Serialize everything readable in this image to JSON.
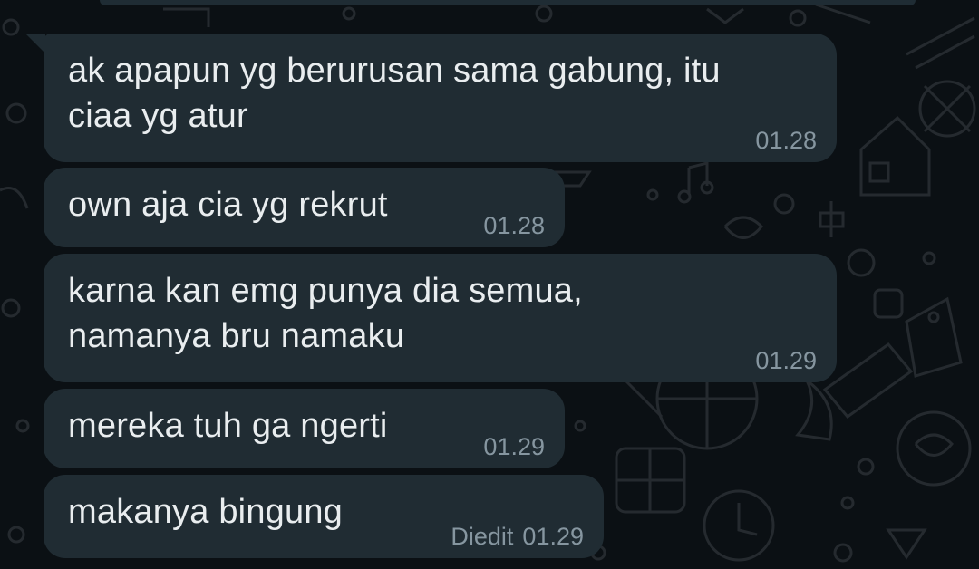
{
  "colors": {
    "background": "#0b1014",
    "bubble": "#202c33",
    "message_text": "#e9edef",
    "meta_text": "#8696a0"
  },
  "messages": [
    {
      "text": "ak apapun yg berurusan sama gabung, itu\nciaa yg atur",
      "time": "01.28",
      "edited_label": ""
    },
    {
      "text": "own aja cia yg rekrut",
      "time": "01.28",
      "edited_label": ""
    },
    {
      "text": "karna kan emg punya dia semua,\nnamanya bru namaku",
      "time": "01.29",
      "edited_label": ""
    },
    {
      "text": "mereka tuh ga ngerti",
      "time": "01.29",
      "edited_label": ""
    },
    {
      "text": "makanya bingung",
      "time": "01.29",
      "edited_label": "Diedit"
    }
  ]
}
